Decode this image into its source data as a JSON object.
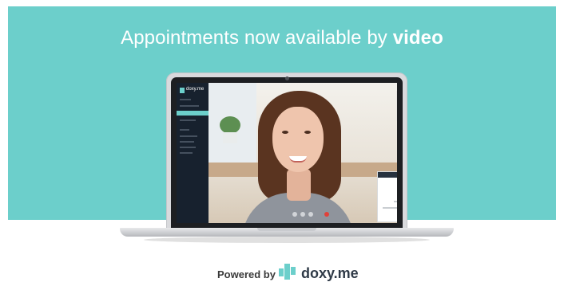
{
  "banner": {
    "headline_prefix": "Appointments now available by",
    "headline_emphasis": "video",
    "background_color": "#6ccfcb"
  },
  "screen": {
    "sidebar_brand": "doxy.me",
    "end_call_color": "#e0413a"
  },
  "footer": {
    "powered_by": "Powered by",
    "brand": "doxy.me",
    "brand_icon": "doxy-me-cross-icon"
  }
}
